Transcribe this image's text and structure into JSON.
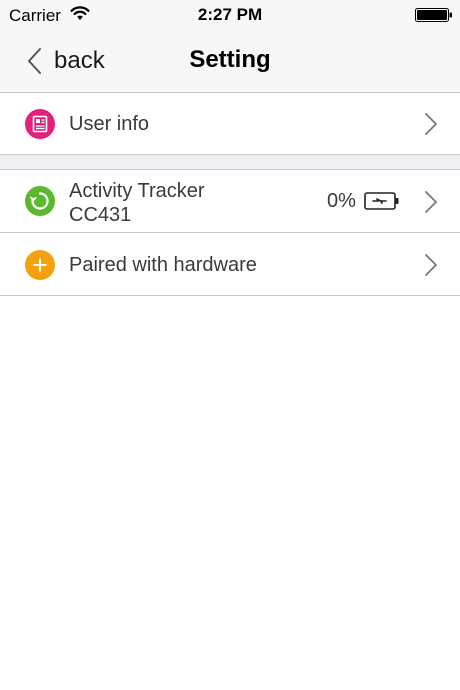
{
  "status_bar": {
    "carrier": "Carrier",
    "time": "2:27 PM",
    "wifi_icon": "wifi-icon",
    "battery_icon": "battery-full-icon"
  },
  "nav": {
    "back_label": "back",
    "title": "Setting",
    "back_icon": "chevron-left-icon"
  },
  "user_info": {
    "label": "User info",
    "icon": "profile-card-icon",
    "icon_color": "#e3217d"
  },
  "device": {
    "name": "Activity Tracker",
    "id": "CC431",
    "battery_percent": "0%",
    "icon": "sync-circle-icon",
    "icon_color": "#5cb82e",
    "battery_icon": "battery-charging-icon"
  },
  "paired": {
    "label": "Paired with hardware",
    "icon": "plus-circle-icon",
    "icon_color": "#f5a10e"
  },
  "chevron_icon": "chevron-right-icon"
}
